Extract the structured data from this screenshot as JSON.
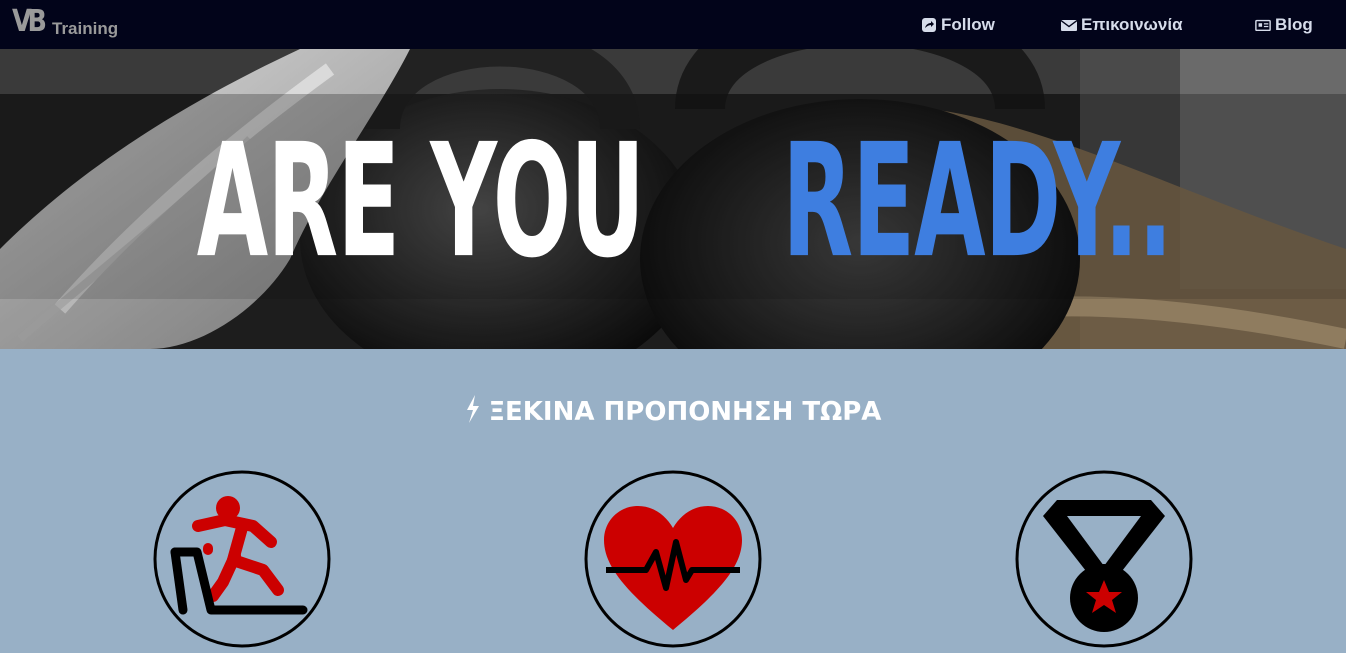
{
  "logo": {
    "mark": "VB",
    "text": "Training"
  },
  "nav": {
    "follow_label": "Follow",
    "contact_label": "Επικοινωνία",
    "blog_label": "Blog"
  },
  "hero": {
    "word_white": "ARE YOU",
    "word_blue": "READY..",
    "accent": "#3e7ee0"
  },
  "section": {
    "title": "ΞΕΚΙΝΑ ΠΡΟΠΟΝΗΣΗ ΤΩΡΑ",
    "background": "#98b0c6"
  },
  "features": [
    {
      "icon": "treadmill-runner-icon"
    },
    {
      "icon": "heartbeat-icon"
    },
    {
      "icon": "medal-icon"
    }
  ],
  "colors": {
    "navbar": "#02041a",
    "icon_red": "#cc0000"
  }
}
